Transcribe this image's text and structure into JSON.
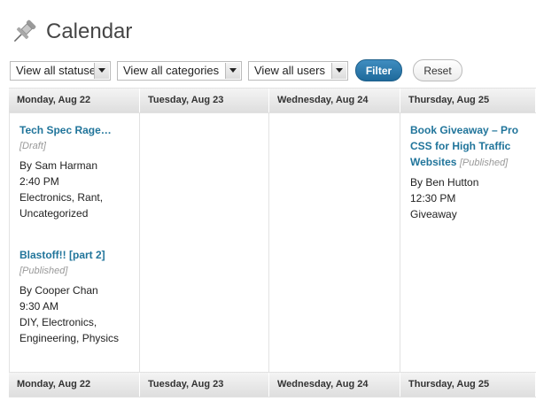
{
  "page": {
    "title": "Calendar"
  },
  "filters": {
    "statuses": "View all statuses",
    "categories": "View all categories",
    "users": "View all users",
    "filter_label": "Filter",
    "reset_label": "Reset"
  },
  "days": [
    "Monday, Aug 22",
    "Tuesday, Aug 23",
    "Wednesday, Aug 24",
    "Thursday, Aug 25"
  ],
  "posts": {
    "monday": [
      {
        "title": "Tech Spec Rage…",
        "status": "[Draft]",
        "author": "By Sam Harman",
        "time": "2:40 PM",
        "categories": "Electronics, Rant, Uncategorized"
      },
      {
        "title": "Blastoff!! [part 2]",
        "status": "[Published]",
        "author": "By Cooper Chan",
        "time": "9:30 AM",
        "categories": "DIY, Electronics, Engineering, Physics"
      }
    ],
    "thursday": [
      {
        "title": "Book Giveaway – Pro CSS for High Traffic Websites",
        "status": "[Published]",
        "author": "By Ben Hutton",
        "time": "12:30 PM",
        "categories": "Giveaway"
      }
    ]
  },
  "icons": {
    "header": "pushpin-icon",
    "dropdown": "chevron-down-icon"
  },
  "colors": {
    "link": "#21759b",
    "filter_button": "#2a7bb0"
  }
}
